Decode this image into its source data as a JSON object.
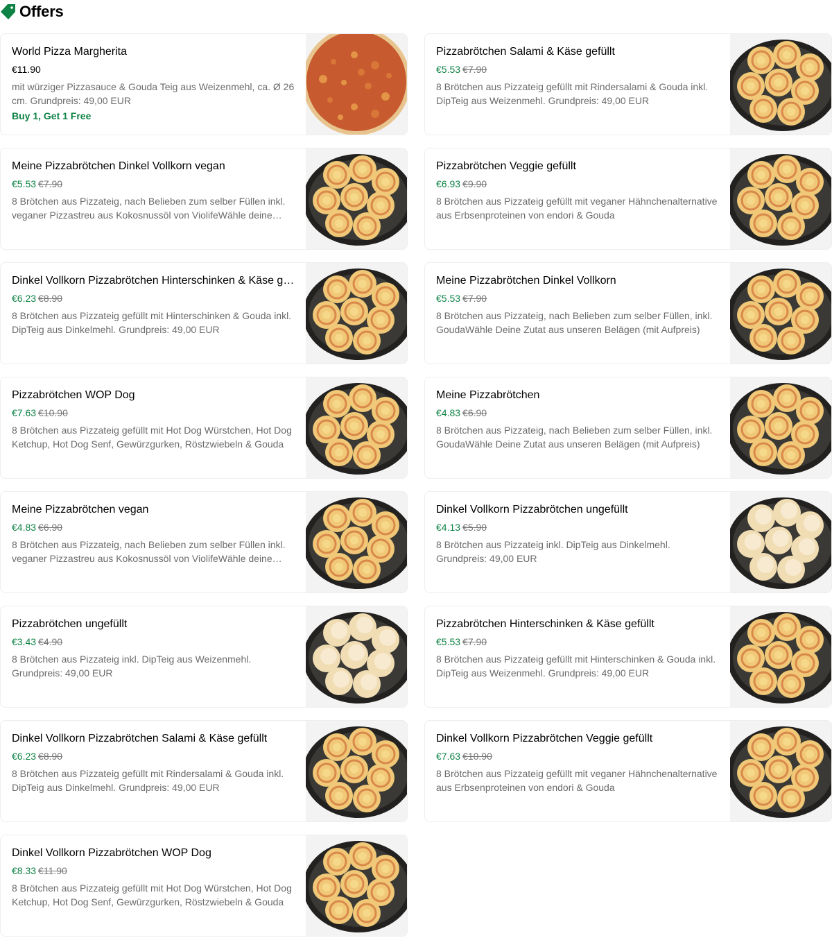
{
  "header": {
    "title": "Offers",
    "icon": "tag-icon",
    "accent": "#0e8345"
  },
  "items": [
    {
      "name": "World Pizza Margherita",
      "price": "€11.90",
      "old_price": "",
      "description": "mit würziger Pizzasauce & Gouda Teig aus Weizenmehl, ca. Ø 26 cm. Grundpreis: 49,00 EUR",
      "promo": "Buy 1, Get 1 Free",
      "image": "pizza-image"
    },
    {
      "name": "Pizzabrötchen Salami & Käse gefüllt",
      "price": "€5.53",
      "old_price": "€7.90",
      "description": "8 Brötchen aus Pizzateig gefüllt mit Rindersalami & Gouda inkl. DipTeig aus Weizenmehl. Grundpreis: 49,00 EUR",
      "promo": "",
      "image": "rolls-image"
    },
    {
      "name": "Meine Pizzabrötchen Dinkel Vollkorn vegan",
      "price": "€5.53",
      "old_price": "€7.90",
      "description": "8 Brötchen aus Pizzateig, nach Belieben zum selber Füllen inkl. veganer Pizzastreu aus Kokosnussöl von ViolifeWähle deine Zutat aus unseren Belägen",
      "promo": "",
      "image": "rolls-image"
    },
    {
      "name": "Pizzabrötchen Veggie gefüllt",
      "price": "€6.93",
      "old_price": "€9.90",
      "description": "8 Brötchen aus Pizzateig gefüllt mit veganer Hähnchenalternative aus Erbsenproteinen von endori & Gouda",
      "promo": "",
      "image": "rolls-image"
    },
    {
      "name": "Dinkel Vollkorn Pizzabrötchen Hinterschinken & Käse gefüllt",
      "price": "€6.23",
      "old_price": "€8.90",
      "description": "8 Brötchen aus Pizzateig gefüllt mit Hinterschinken & Gouda inkl. DipTeig aus Dinkelmehl. Grundpreis: 49,00 EUR",
      "promo": "",
      "image": "rolls-image"
    },
    {
      "name": "Meine Pizzabrötchen Dinkel Vollkorn",
      "price": "€5.53",
      "old_price": "€7.90",
      "description": "8 Brötchen aus Pizzateig, nach Belieben zum selber Füllen, inkl. GoudaWähle Deine Zutat aus unseren Belägen (mit Aufpreis)",
      "promo": "",
      "image": "rolls-image"
    },
    {
      "name": "Pizzabrötchen WOP Dog",
      "price": "€7.63",
      "old_price": "€10.90",
      "description": "8 Brötchen aus Pizzateig gefüllt mit Hot Dog Würstchen, Hot Dog Ketchup, Hot Dog Senf, Gewürzgurken, Röstzwiebeln & Gouda",
      "promo": "",
      "image": "rolls-image"
    },
    {
      "name": "Meine Pizzabrötchen",
      "price": "€4.83",
      "old_price": "€6.90",
      "description": "8 Brötchen aus Pizzateig, nach Belieben zum selber Füllen, inkl. GoudaWähle Deine Zutat aus unseren Belägen (mit Aufpreis)",
      "promo": "",
      "image": "rolls-image"
    },
    {
      "name": "Meine Pizzabrötchen vegan",
      "price": "€4.83",
      "old_price": "€6.90",
      "description": "8 Brötchen aus Pizzateig, nach Belieben zum selber Füllen inkl. veganer Pizzastreu aus Kokosnussöl von ViolifeWähle deine Zutat aus unseren Belägen",
      "promo": "",
      "image": "rolls-image"
    },
    {
      "name": "Dinkel Vollkorn Pizzabrötchen ungefüllt",
      "price": "€4.13",
      "old_price": "€5.90",
      "description": "8 Brötchen aus Pizzateig inkl. DipTeig aus Dinkelmehl. Grundpreis: 49,00 EUR",
      "promo": "",
      "image": "plain-rolls-image"
    },
    {
      "name": "Pizzabrötchen ungefüllt",
      "price": "€3.43",
      "old_price": "€4.90",
      "description": "8 Brötchen aus Pizzateig inkl. DipTeig aus Weizenmehl. Grundpreis: 49,00 EUR",
      "promo": "",
      "image": "plain-rolls-image"
    },
    {
      "name": "Pizzabrötchen Hinterschinken & Käse gefüllt",
      "price": "€5.53",
      "old_price": "€7.90",
      "description": "8 Brötchen aus Pizzateig gefüllt mit Hinterschinken & Gouda inkl. DipTeig aus Weizenmehl. Grundpreis: 49,00 EUR",
      "promo": "",
      "image": "rolls-image"
    },
    {
      "name": "Dinkel Vollkorn Pizzabrötchen Salami & Käse gefüllt",
      "price": "€6.23",
      "old_price": "€8.90",
      "description": "8 Brötchen aus Pizzateig gefüllt mit Rindersalami & Gouda inkl. DipTeig aus Dinkelmehl. Grundpreis: 49,00 EUR",
      "promo": "",
      "image": "rolls-image"
    },
    {
      "name": "Dinkel Vollkorn Pizzabrötchen Veggie gefüllt",
      "price": "€7.63",
      "old_price": "€10.90",
      "description": "8 Brötchen aus Pizzateig gefüllt mit veganer Hähnchenalternative aus Erbsenproteinen von endori & Gouda",
      "promo": "",
      "image": "rolls-image"
    },
    {
      "name": "Dinkel Vollkorn Pizzabrötchen WOP Dog",
      "price": "€8.33",
      "old_price": "€11.90",
      "description": "8 Brötchen aus Pizzateig gefüllt mit Hot Dog Würstchen, Hot Dog Ketchup, Hot Dog Senf, Gewürzgurken, Röstzwiebeln & Gouda",
      "promo": "",
      "image": "rolls-image"
    }
  ]
}
